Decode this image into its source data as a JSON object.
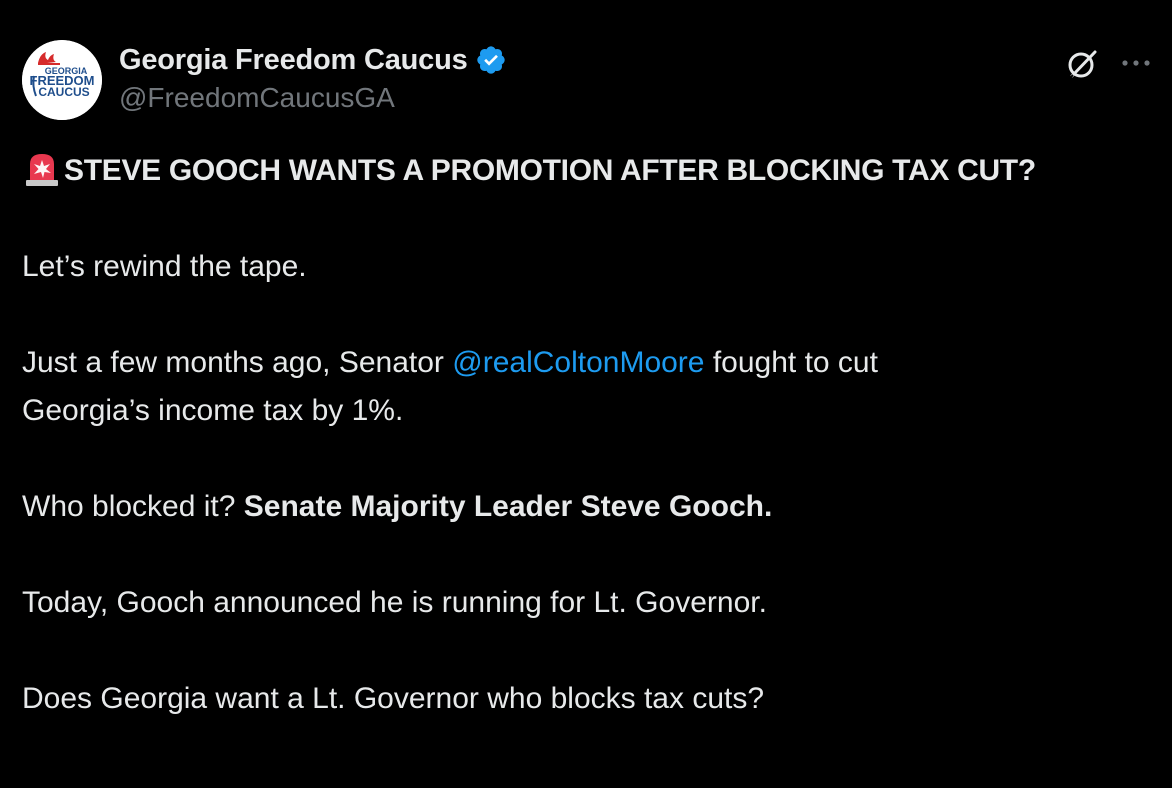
{
  "account": {
    "display_name": "Georgia Freedom Caucus",
    "handle": "@FreedomCaucusGA",
    "verified": true,
    "avatar_logo": {
      "line1": "GEORGIA",
      "line2": "FREEDOM",
      "line3": "CAUCUS",
      "color": "#1f4e8c",
      "flame_color": "#d62b2b"
    }
  },
  "header_icons": {
    "grok": "grok-icon",
    "more": "more-icon"
  },
  "post": {
    "headline_emoji": "police-car-light-icon",
    "headline": "STEVE GOOCH WANTS A PROMOTION AFTER BLOCKING TAX CUT?",
    "p1": "Let’s rewind the tape.",
    "p2_before": "Just a few months ago, Senator ",
    "p2_mention": "@realColtonMoore",
    "p2_after": " fought to cut",
    "p2_line2": "Georgia’s income tax by 1%.",
    "p3_before": "Who blocked it? ",
    "p3_bold": "Senate Majority Leader Steve Gooch.",
    "p4": "Today, Gooch announced he is running for Lt. Governor.",
    "p5": "Does Georgia want a Lt. Governor who blocks tax cuts?"
  },
  "colors": {
    "background": "#000000",
    "text": "#e7e9ea",
    "secondary_text": "#71767b",
    "link": "#1d9bf0",
    "verified_badge": "#1d9bf0"
  }
}
